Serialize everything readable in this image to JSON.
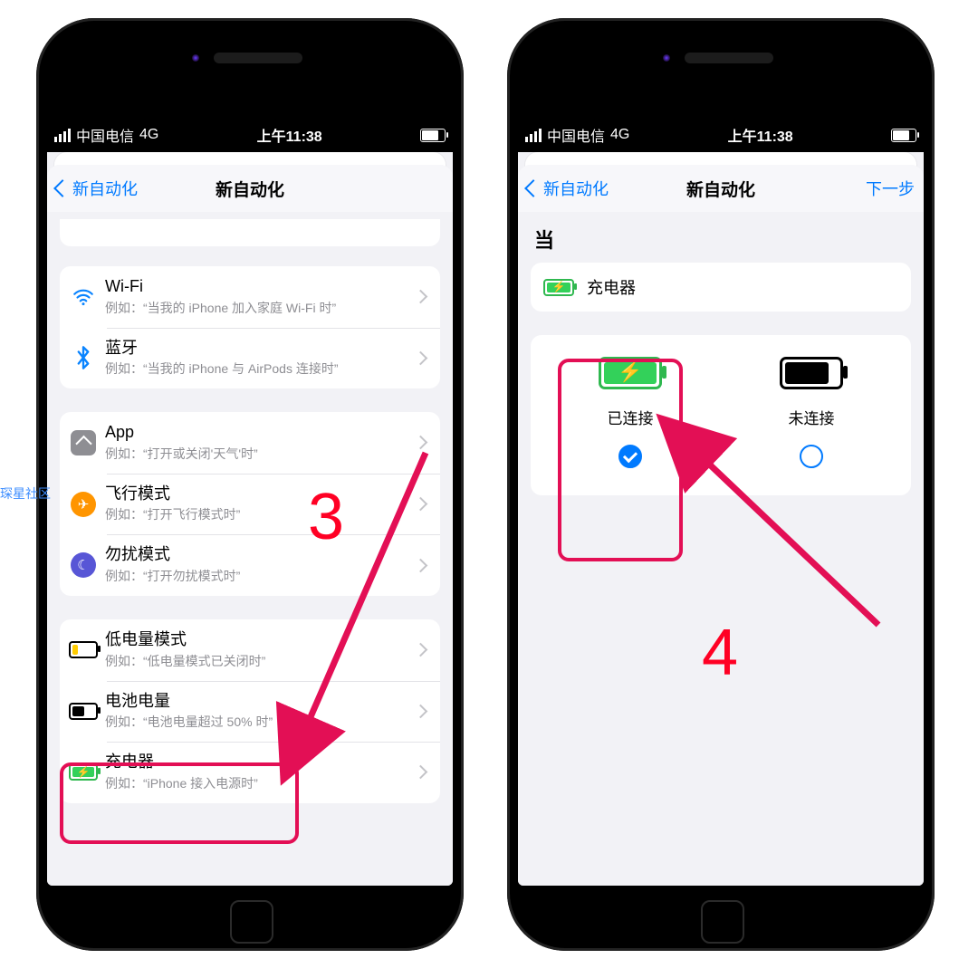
{
  "watermark": "琛星社区",
  "status": {
    "carrier": "中国电信",
    "network": "4G",
    "time": "上午11:38"
  },
  "annotations": {
    "step3": "3",
    "step4": "4"
  },
  "left": {
    "nav": {
      "back": "新自动化",
      "title": "新自动化"
    },
    "rows": {
      "wifi": {
        "title": "Wi-Fi",
        "sub": "例如：“当我的 iPhone 加入家庭 Wi-Fi 时”"
      },
      "bt": {
        "title": "蓝牙",
        "sub": "例如：“当我的 iPhone 与 AirPods 连接时”"
      },
      "app": {
        "title": "App",
        "sub": "例如：“打开或关闭'天气'时”"
      },
      "plane": {
        "title": "飞行模式",
        "sub": "例如：“打开飞行模式时”"
      },
      "dnd": {
        "title": "勿扰模式",
        "sub": "例如：“打开勿扰模式时”"
      },
      "low": {
        "title": "低电量模式",
        "sub": "例如：“低电量模式已关闭时”"
      },
      "level": {
        "title": "电池电量",
        "sub": "例如：“电池电量超过 50% 时”"
      },
      "chg": {
        "title": "充电器",
        "sub": "例如：“iPhone 接入电源时”"
      }
    }
  },
  "right": {
    "nav": {
      "back": "新自动化",
      "title": "新自动化",
      "next": "下一步"
    },
    "when": "当",
    "charger_label": "充电器",
    "opts": {
      "connected": {
        "label": "已连接"
      },
      "disconnected": {
        "label": "未连接"
      }
    }
  }
}
